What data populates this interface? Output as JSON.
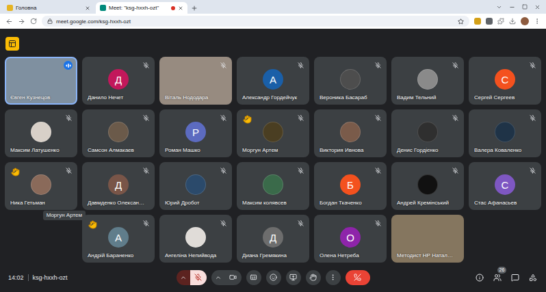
{
  "browser": {
    "tabs": [
      {
        "label": "Головна",
        "selected": false,
        "recording": false
      },
      {
        "label": "Meet: \"ksg-hxxh-ozt\"",
        "selected": true,
        "recording": true
      }
    ],
    "url": "meet.google.com/ksg-hxxh-ozt"
  },
  "meeting": {
    "tile_rows": [
      {
        "tiles": [
          {
            "name": "Євген Кузнецов",
            "kind": "video",
            "color": "#7f90a0",
            "muted": false,
            "speaking": true,
            "reaction": false
          },
          {
            "name": "Данило Нечет",
            "kind": "letter",
            "letter": "Д",
            "color": "#c2185b",
            "muted": true,
            "speaking": false,
            "reaction": false
          },
          {
            "name": "Віталь Нододара",
            "kind": "video",
            "color": "#978b80",
            "muted": true,
            "speaking": false,
            "reaction": false
          },
          {
            "name": "Александр Гордейчук",
            "kind": "letter",
            "letter": "А",
            "color": "#1a5fa8",
            "muted": true,
            "speaking": false,
            "reaction": false
          },
          {
            "name": "Вероника Басараб",
            "kind": "photo",
            "color": "#4d4d4d",
            "muted": true,
            "speaking": false,
            "reaction": false
          },
          {
            "name": "Вадим Тельний",
            "kind": "photo",
            "color": "#8a8a8a",
            "muted": true,
            "speaking": false,
            "reaction": false
          },
          {
            "name": "Сергей Сергеев",
            "kind": "letter",
            "letter": "С",
            "color": "#f4511e",
            "muted": true,
            "speaking": false,
            "reaction": false
          }
        ]
      },
      {
        "tiles": [
          {
            "name": "Максим Латушенко",
            "kind": "photo",
            "color": "#d8d0c8",
            "muted": true,
            "speaking": false,
            "reaction": false
          },
          {
            "name": "Самсон Алмакаев",
            "kind": "photo",
            "color": "#6b5a4a",
            "muted": true,
            "speaking": false,
            "reaction": false
          },
          {
            "name": "Роман Машко",
            "kind": "letter",
            "letter": "Р",
            "color": "#5c6bc0",
            "muted": true,
            "speaking": false,
            "reaction": false
          },
          {
            "name": "Моргун Артем",
            "kind": "photo",
            "color": "#4a3e22",
            "muted": true,
            "speaking": false,
            "reaction": true
          },
          {
            "name": "Виктория Ивнова",
            "kind": "photo",
            "color": "#7a5b4a",
            "muted": true,
            "speaking": false,
            "reaction": false
          },
          {
            "name": "Денис Гордієнко",
            "kind": "photo",
            "color": "#2f2f2f",
            "muted": true,
            "speaking": false,
            "reaction": false
          },
          {
            "name": "Валера Коваленко",
            "kind": "photo",
            "color": "#1f3347",
            "muted": true,
            "speaking": false,
            "reaction": false
          }
        ]
      },
      {
        "tiles": [
          {
            "name": "Ника Гетьман",
            "kind": "photo",
            "color": "#8a6a5a",
            "muted": true,
            "speaking": false,
            "reaction": true,
            "tooltip": "Моргун Артем"
          },
          {
            "name": "Давмденко Олексан…",
            "kind": "letter",
            "letter": "Д",
            "color": "#795548",
            "muted": true,
            "speaking": false,
            "reaction": false
          },
          {
            "name": "Юрий Дробот",
            "kind": "photo",
            "color": "#2b4a6b",
            "muted": true,
            "speaking": false,
            "reaction": false
          },
          {
            "name": "Максим колявсев",
            "kind": "photo",
            "color": "#3a6a4a",
            "muted": true,
            "speaking": false,
            "reaction": false
          },
          {
            "name": "Богдан Ткаченко",
            "kind": "letter",
            "letter": "Б",
            "color": "#f4511e",
            "muted": true,
            "speaking": false,
            "reaction": false
          },
          {
            "name": "Андрей Кремінський",
            "kind": "photo",
            "color": "#111111",
            "muted": true,
            "speaking": false,
            "reaction": false
          },
          {
            "name": "Стас Афанасьев",
            "kind": "letter",
            "letter": "С",
            "color": "#7e57c2",
            "muted": true,
            "speaking": false,
            "reaction": false
          }
        ]
      },
      {
        "tiles": [
          {
            "name": "Андрій Бараненко",
            "kind": "letter",
            "letter": "А",
            "color": "#607d8b",
            "muted": true,
            "speaking": false,
            "reaction": true
          },
          {
            "name": "Ангеліна Непийвода",
            "kind": "photo",
            "color": "#e0dcd8",
            "muted": true,
            "speaking": false,
            "reaction": false
          },
          {
            "name": "Диана Гремякина",
            "kind": "letter",
            "letter": "Д",
            "color": "#6d6d6d",
            "muted": true,
            "speaking": false,
            "reaction": false
          },
          {
            "name": "Олена Нетреба",
            "kind": "letter",
            "letter": "О",
            "color": "#8e24aa",
            "muted": true,
            "speaking": false,
            "reaction": false
          },
          {
            "name": "Методист НР Натал…",
            "kind": "video",
            "color": "#85765f",
            "muted": false,
            "speaking": false,
            "reaction": false
          }
        ]
      }
    ]
  },
  "toolbar": {
    "time": "14:02",
    "meeting_code": "ksg-hxxh-ozt",
    "mic_muted": true,
    "camera_off": false,
    "hand_raised": false,
    "participants_count": "26"
  }
}
